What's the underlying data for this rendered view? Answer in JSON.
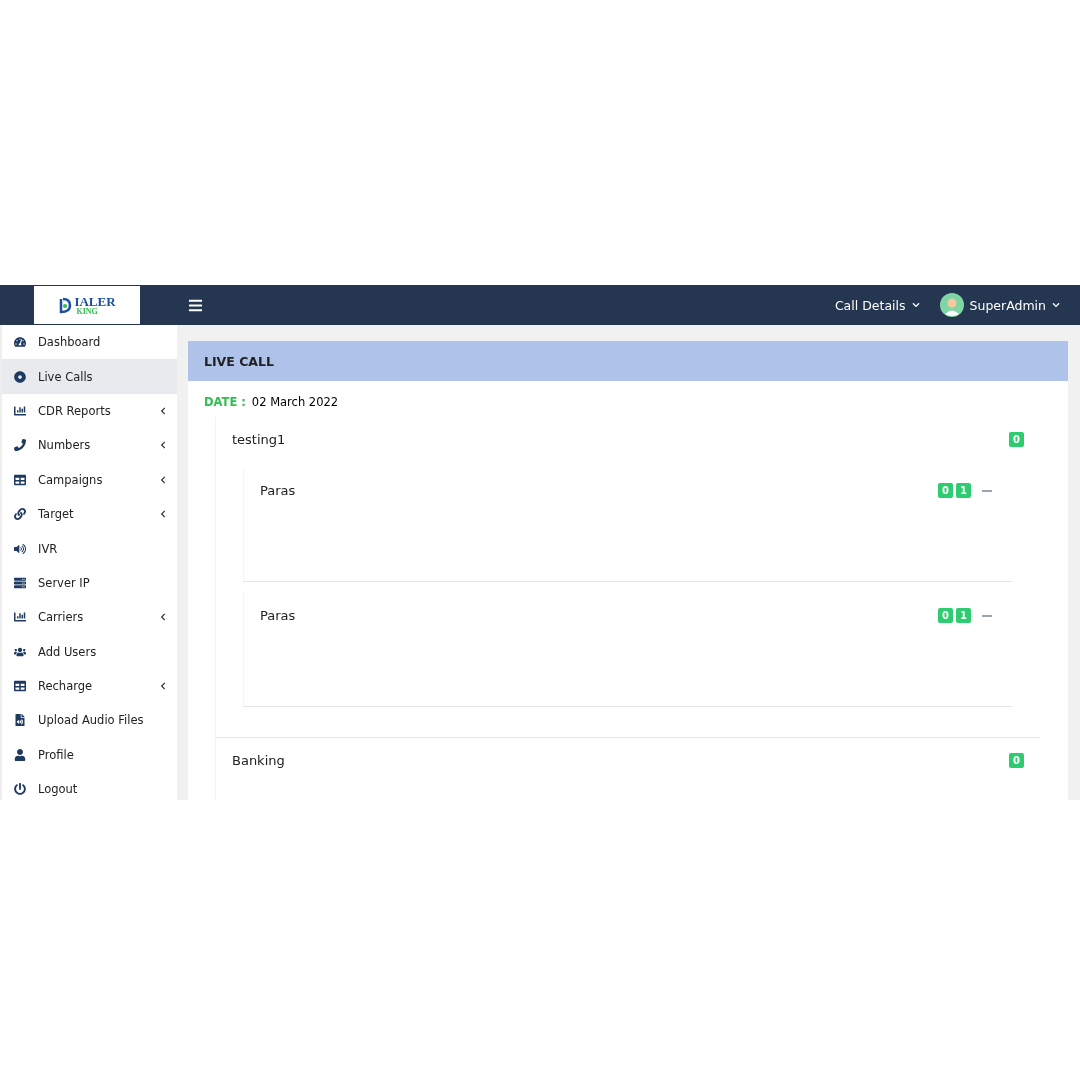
{
  "logo": {
    "line1": "IALER",
    "line2": "KING"
  },
  "topbar": {
    "menus": [
      {
        "label": "Call Details",
        "kind": "menu"
      },
      {
        "label": "SuperAdmin",
        "kind": "user"
      }
    ]
  },
  "sidebar": {
    "items": [
      {
        "label": "Dashboard",
        "kind": "gauge",
        "selected": false,
        "has_submenu": false
      },
      {
        "label": "Live Calls",
        "kind": "target",
        "selected": true,
        "has_submenu": false
      },
      {
        "label": "CDR Reports",
        "kind": "chart",
        "selected": false,
        "has_submenu": true
      },
      {
        "label": "Numbers",
        "kind": "phone",
        "selected": false,
        "has_submenu": true
      },
      {
        "label": "Campaigns",
        "kind": "table",
        "selected": false,
        "has_submenu": true
      },
      {
        "label": "Target",
        "kind": "link",
        "selected": false,
        "has_submenu": true
      },
      {
        "label": "IVR",
        "kind": "volume",
        "selected": false,
        "has_submenu": false
      },
      {
        "label": "Server IP",
        "kind": "server",
        "selected": false,
        "has_submenu": false
      },
      {
        "label": "Carriers",
        "kind": "chart",
        "selected": false,
        "has_submenu": true
      },
      {
        "label": "Add Users",
        "kind": "users",
        "selected": false,
        "has_submenu": false
      },
      {
        "label": "Recharge",
        "kind": "table",
        "selected": false,
        "has_submenu": true
      },
      {
        "label": "Upload Audio Files",
        "kind": "audio",
        "selected": false,
        "has_submenu": false
      },
      {
        "label": "Profile",
        "kind": "user",
        "selected": false,
        "has_submenu": false
      },
      {
        "label": "Logout",
        "kind": "power",
        "selected": false,
        "has_submenu": false
      }
    ]
  },
  "panel": {
    "title": "LIVE CALL",
    "date_label": "DATE :",
    "date": "02 March 2022",
    "groups": [
      {
        "name": "testing1",
        "count": "0",
        "calls": [
          {
            "name": "Paras",
            "badges": [
              "0",
              "1"
            ]
          },
          {
            "name": "Paras",
            "badges": [
              "0",
              "1"
            ]
          }
        ]
      },
      {
        "name": "Banking",
        "count": "0"
      }
    ]
  }
}
